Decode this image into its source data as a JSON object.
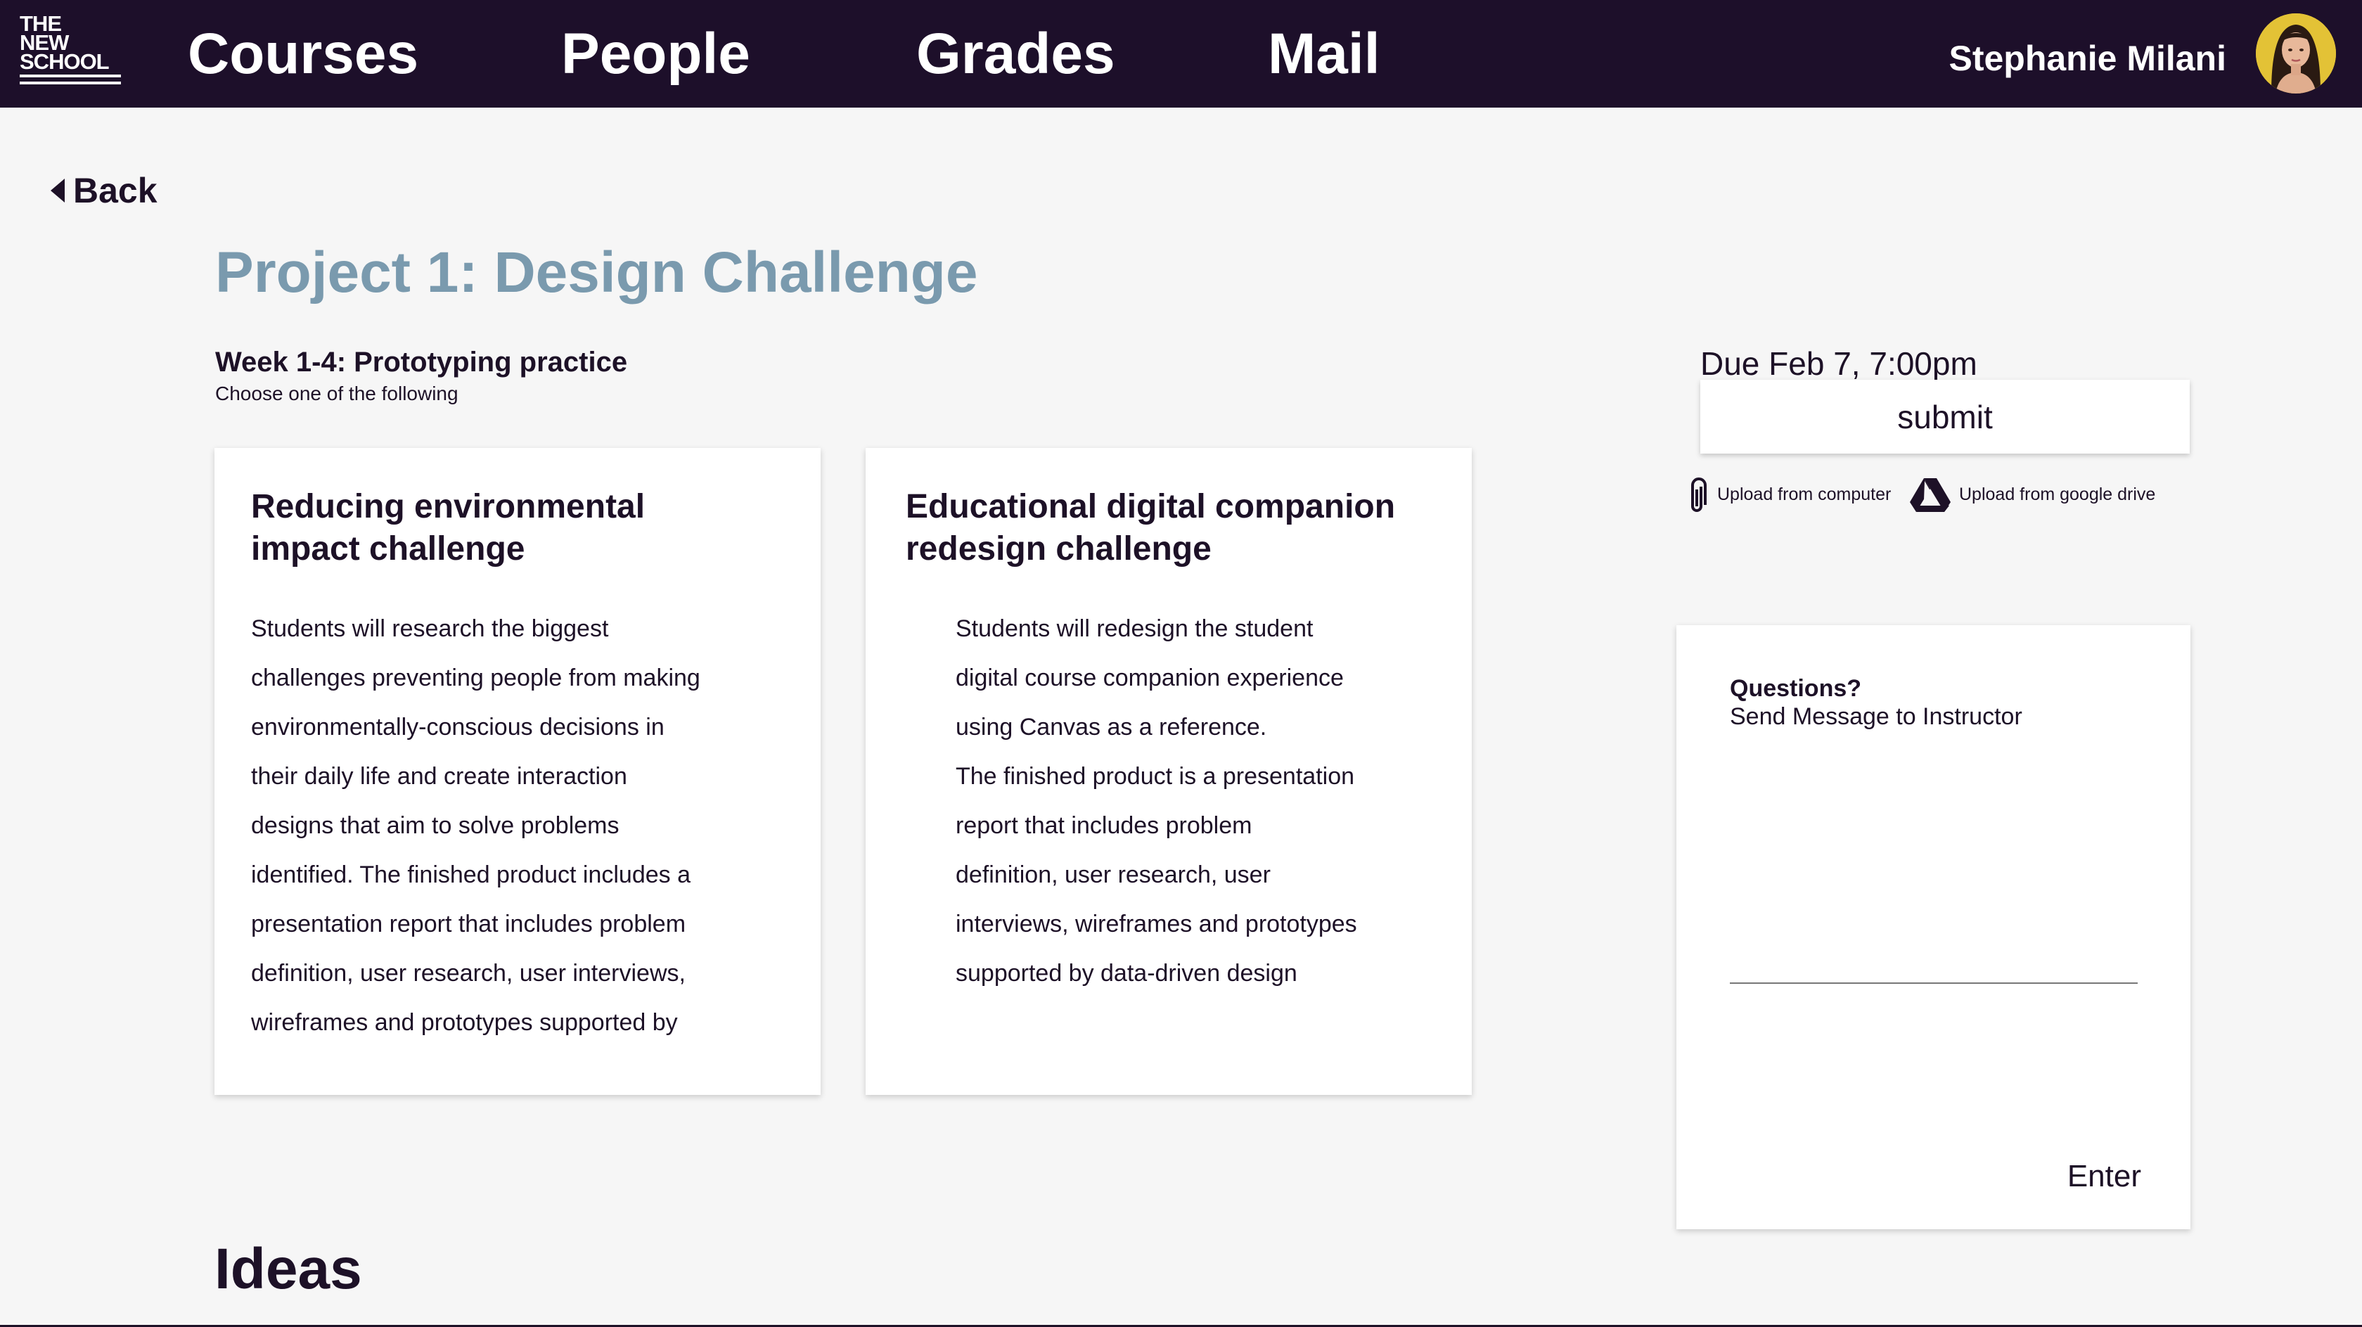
{
  "logo": {
    "line1": "THE",
    "line2": "NEW",
    "line3": "SCHOOL"
  },
  "nav": {
    "items": [
      {
        "label": "Courses"
      },
      {
        "label": "People"
      },
      {
        "label": "Grades"
      },
      {
        "label": "Mail"
      }
    ],
    "user_name": "Stephanie Milani",
    "avatar_icon": "user-avatar"
  },
  "back_label": "Back",
  "page_title": "Project 1: Design Challenge",
  "week": {
    "title": "Week 1-4: Prototyping practice",
    "subtitle": "Choose one of the following"
  },
  "cards": [
    {
      "title": "Reducing environmental impact challenge",
      "body": [
        "Students will research the biggest",
        "challenges preventing people from making",
        "environmentally-conscious decisions in",
        "their daily life and create interaction",
        "designs that aim to solve problems",
        "identified. The finished product includes a",
        "presentation report that includes problem",
        "definition, user research, user interviews,",
        "wireframes and prototypes supported by"
      ]
    },
    {
      "title": "Educational digital companion redesign challenge",
      "body": [
        "Students will redesign the student",
        "digital course companion experience",
        "using Canvas as a reference.",
        "The finished product is a presentation",
        "report that includes problem",
        "definition, user research, user",
        "interviews, wireframes and prototypes",
        "supported by data-driven design"
      ]
    }
  ],
  "submission": {
    "due": "Due Feb 7, 7:00pm",
    "submit_label": "submit",
    "upload_computer": "Upload from computer",
    "upload_drive": "Upload from google drive"
  },
  "messages": {
    "question": "Questions?",
    "send": "Send Message to Instructor",
    "input_value": "",
    "enter_label": "Enter"
  },
  "ideas_heading": "Ideas",
  "colors": {
    "nav_bg": "#1d0f2a",
    "title_accent": "#7a9aae",
    "page_bg": "#f6f6f6",
    "text": "#1d1127"
  }
}
